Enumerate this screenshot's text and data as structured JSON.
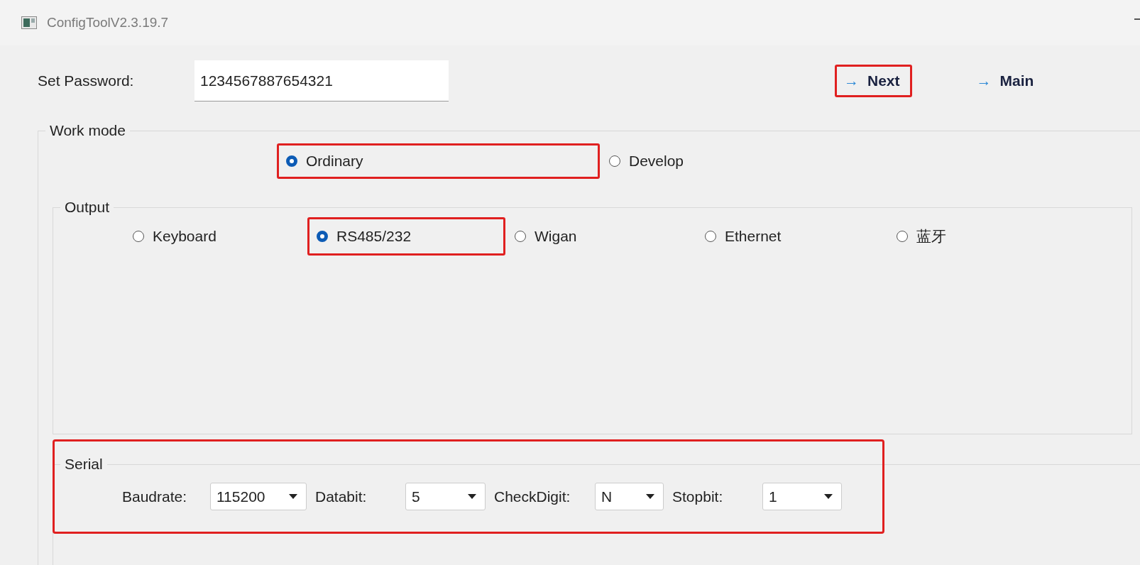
{
  "window": {
    "title": "ConfigToolV2.3.19.7"
  },
  "password": {
    "label": "Set Password:",
    "value": "1234567887654321"
  },
  "nav_buttons": [
    {
      "arrow": "→",
      "label": "Next",
      "highlighted": true
    },
    {
      "arrow": "→",
      "label": "Main",
      "highlighted": false
    }
  ],
  "work_mode": {
    "title": "Work mode",
    "options": [
      {
        "label": "Ordinary",
        "selected": true,
        "highlighted": true
      },
      {
        "label": "Develop",
        "selected": false,
        "highlighted": false
      }
    ]
  },
  "output": {
    "title": "Output",
    "options": [
      {
        "label": "Keyboard",
        "selected": false,
        "highlighted": false
      },
      {
        "label": "RS485/232",
        "selected": true,
        "highlighted": true
      },
      {
        "label": "Wigan",
        "selected": false,
        "highlighted": false
      },
      {
        "label": "Ethernet",
        "selected": false,
        "highlighted": false
      },
      {
        "label": "蓝牙",
        "selected": false,
        "highlighted": false
      }
    ]
  },
  "serial": {
    "title": "Serial",
    "highlighted": true,
    "fields": [
      {
        "label": "Baudrate:",
        "value": "115200"
      },
      {
        "label": "Databit:",
        "value": "5"
      },
      {
        "label": "CheckDigit:",
        "value": "N"
      },
      {
        "label": "Stopbit:",
        "value": "1"
      }
    ]
  }
}
